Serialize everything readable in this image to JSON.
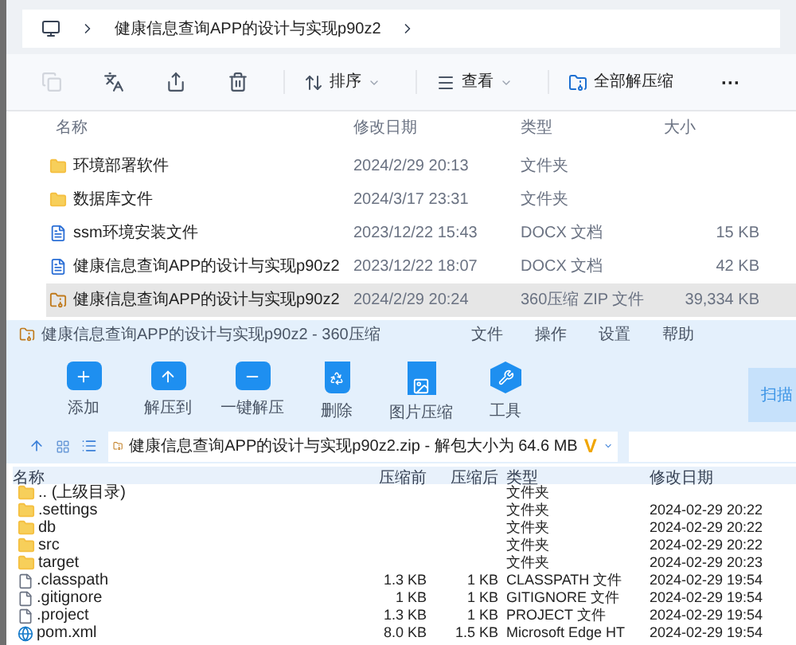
{
  "explorer": {
    "breadcrumb": [
      {
        "label": "健康信息查询APP的设计与实现p90z2"
      }
    ],
    "toolbar": [
      {
        "kind": "copy"
      },
      {
        "kind": "rename"
      },
      {
        "kind": "share"
      },
      {
        "kind": "delete"
      },
      {
        "kind": "sort",
        "label": "排序"
      },
      {
        "kind": "view",
        "label": "查看"
      },
      {
        "kind": "extract",
        "label": "全部解压缩"
      },
      {
        "kind": "more",
        "label": "···"
      }
    ],
    "columns": [
      "名称",
      "修改日期",
      "类型",
      "大小"
    ],
    "rows": [
      {
        "kind": "folder",
        "name": "环境部署软件",
        "date": "2024/2/29 20:13",
        "type": "文件夹",
        "size": "",
        "selected": false
      },
      {
        "kind": "folder",
        "name": "数据库文件",
        "date": "2024/3/17 23:31",
        "type": "文件夹",
        "size": "",
        "selected": false
      },
      {
        "kind": "docx",
        "name": "ssm环境安装文件",
        "date": "2023/12/22 15:43",
        "type": "DOCX 文档",
        "size": "15 KB",
        "selected": false
      },
      {
        "kind": "docx",
        "name": "健康信息查询APP的设计与实现p90z2",
        "date": "2023/12/22 18:07",
        "type": "DOCX 文档",
        "size": "42 KB",
        "selected": false
      },
      {
        "kind": "zip",
        "name": "健康信息查询APP的设计与实现p90z2",
        "date": "2024/2/29 20:24",
        "type": "360压缩 ZIP 文件",
        "size": "39,334 KB",
        "selected": true
      }
    ]
  },
  "zip_window": {
    "title": "健康信息查询APP的设计与实现p90z2 - 360压缩",
    "menu": [
      "文件",
      "操作",
      "设置",
      "帮助"
    ],
    "tools": [
      {
        "kind": "add",
        "label": "添加"
      },
      {
        "kind": "extract_to",
        "label": "解压到"
      },
      {
        "kind": "one_click",
        "label": "一键解压"
      },
      {
        "kind": "delete",
        "label": "删除"
      },
      {
        "kind": "image",
        "label": "图片压缩"
      },
      {
        "kind": "tools",
        "label": "工具"
      }
    ],
    "scan_label": "扫描",
    "path": "健康信息查询APP的设计与实现p90z2.zip - 解包大小为 64.6 MB",
    "path_badge": "V",
    "columns": [
      "名称",
      "压缩前",
      "压缩后",
      "类型",
      "修改日期"
    ],
    "rows": [
      {
        "kind": "folder",
        "name": ".. (上级目录)",
        "before": "",
        "after": "",
        "type": "文件夹",
        "date": ""
      },
      {
        "kind": "folder",
        "name": ".settings",
        "before": "",
        "after": "",
        "type": "文件夹",
        "date": "2024-02-29 20:22"
      },
      {
        "kind": "folder",
        "name": "db",
        "before": "",
        "after": "",
        "type": "文件夹",
        "date": "2024-02-29 20:22"
      },
      {
        "kind": "folder",
        "name": "src",
        "before": "",
        "after": "",
        "type": "文件夹",
        "date": "2024-02-29 20:22"
      },
      {
        "kind": "folder",
        "name": "target",
        "before": "",
        "after": "",
        "type": "文件夹",
        "date": "2024-02-29 20:23"
      },
      {
        "kind": "file",
        "name": ".classpath",
        "before": "1.3 KB",
        "after": "1 KB",
        "type": "CLASSPATH 文件",
        "date": "2024-02-29 19:54"
      },
      {
        "kind": "file",
        "name": ".gitignore",
        "before": "1 KB",
        "after": "1 KB",
        "type": "GITIGNORE 文件",
        "date": "2024-02-29 19:54"
      },
      {
        "kind": "file",
        "name": ".project",
        "before": "1.3 KB",
        "after": "1 KB",
        "type": "PROJECT 文件",
        "date": "2024-02-29 19:54"
      },
      {
        "kind": "edge",
        "name": "pom.xml",
        "before": "8.0 KB",
        "after": "1.5 KB",
        "type": "Microsoft Edge HT",
        "date": "2024-02-29 19:54"
      }
    ]
  }
}
